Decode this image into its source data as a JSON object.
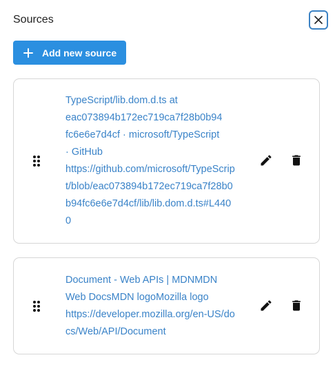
{
  "header": {
    "title": "Sources"
  },
  "toolbar": {
    "add_label": "Add new source"
  },
  "sources": [
    {
      "title": "TypeScript/lib.dom.d.ts at eac073894b172ec719ca7f28b0b94fc6e6e7d4cf · microsoft/TypeScript · GitHub",
      "title_lines": [
        "TypeScript/lib.dom.d.ts at",
        "eac073894b172ec719ca7f28b0b94",
        "fc6e6e7d4cf · microsoft/TypeScript",
        "· GitHub"
      ],
      "url": "https://github.com/microsoft/TypeScript/blob/eac073894b172ec719ca7f28b0b94fc6e6e7d4cf/lib/lib.dom.d.ts#L4400"
    },
    {
      "title": "Document - Web APIs | MDNMDN Web DocsMDN logoMozilla logo",
      "title_lines": [
        "Document - Web APIs | MDNMDN",
        "Web DocsMDN logoMozilla logo"
      ],
      "url": "https://developer.mozilla.org/en-US/docs/Web/API/Document"
    }
  ],
  "icons": {
    "close": "close-icon",
    "add": "plus-icon",
    "drag": "drag-handle-icon",
    "edit": "pencil-icon",
    "delete": "trash-icon"
  },
  "colors": {
    "accent": "#2b8fe0",
    "link": "#3a83c8",
    "focus_border": "#3b82c4",
    "card_border": "#d6d6d6",
    "icon": "#111111"
  }
}
